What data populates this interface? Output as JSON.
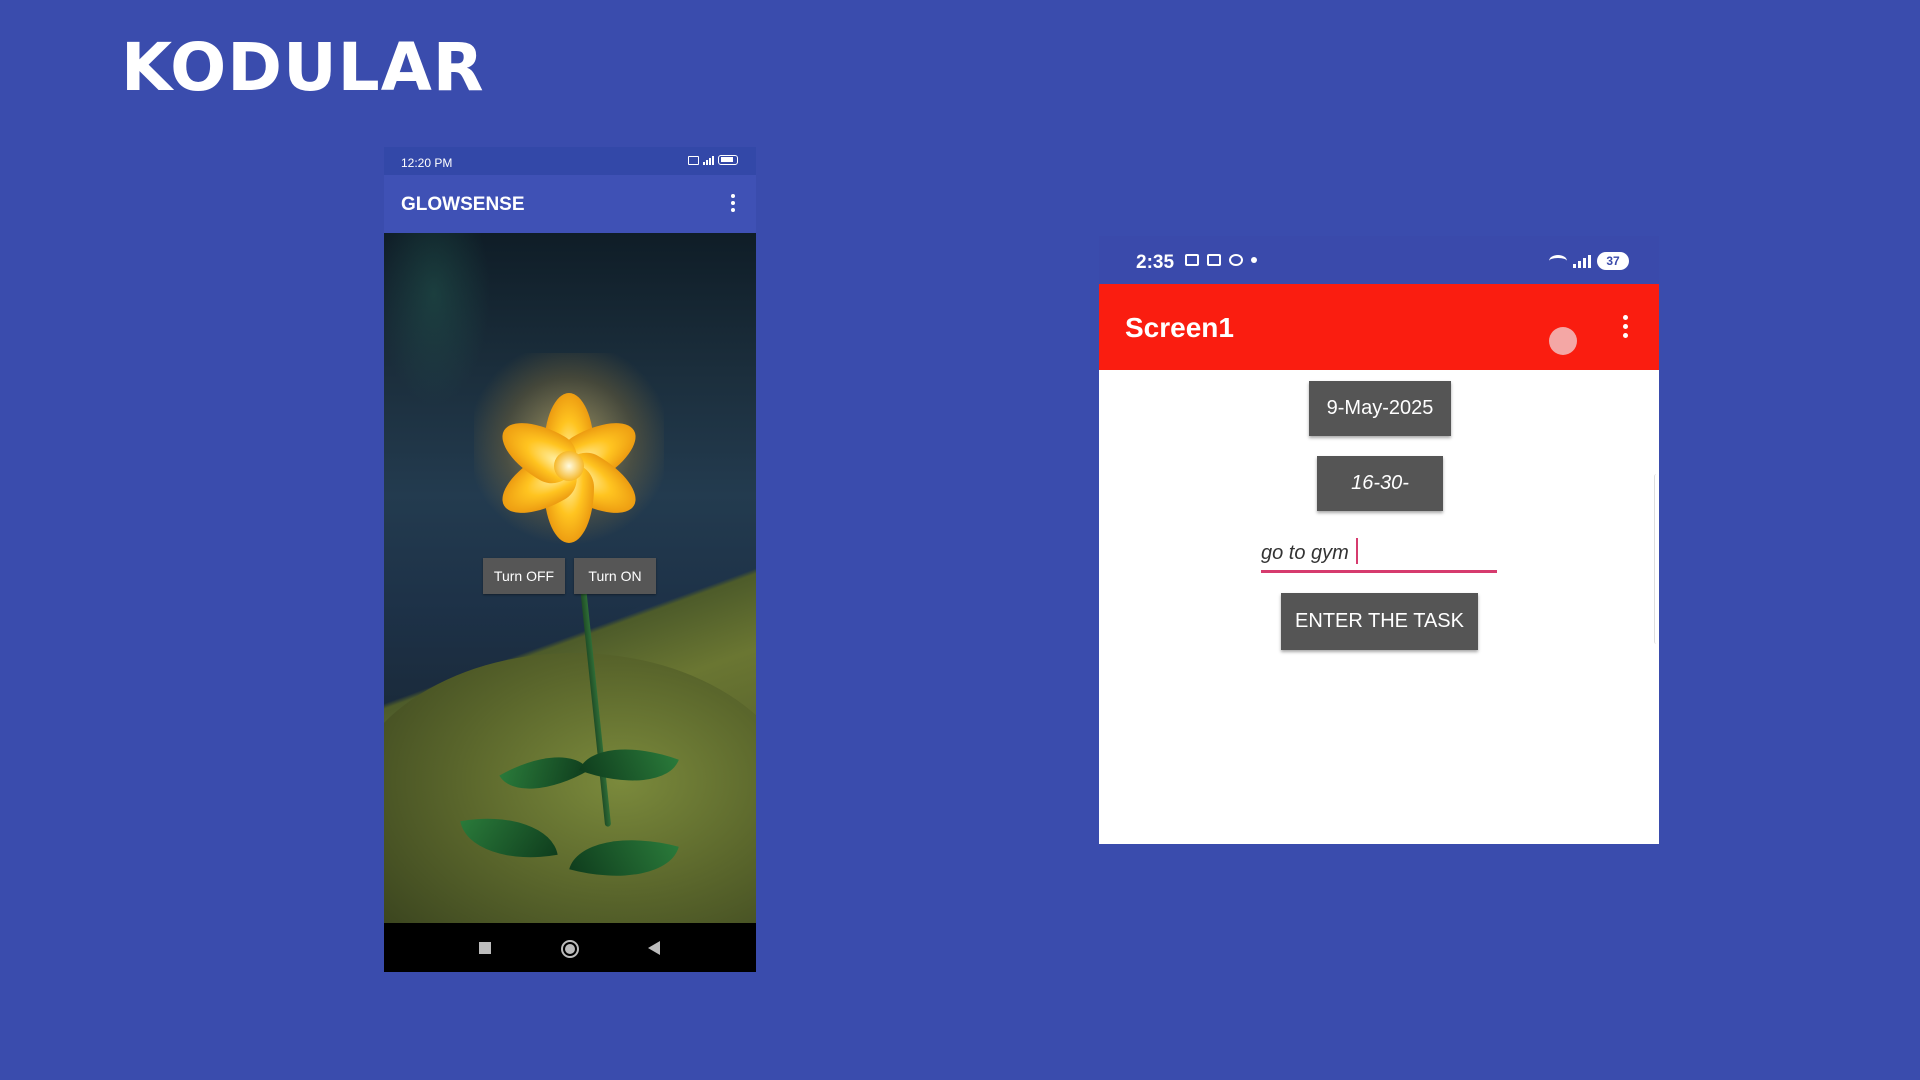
{
  "slide": {
    "title": "KODULAR"
  },
  "phone1": {
    "status_time": "12:20 PM",
    "app_title": "GLOWSENSE",
    "buttons": {
      "turn_off": "Turn OFF",
      "turn_on": "Turn ON"
    }
  },
  "phone2": {
    "status_time": "2:35",
    "battery": "37",
    "app_title": "Screen1",
    "date_button": "9-May-2025",
    "time_button": "16-30-",
    "task_input_value": "go to gym",
    "enter_button": "ENTER THE TASK"
  },
  "colors": {
    "slide_background": "#3a4cad",
    "phone1_appbar": "#3f51b5",
    "phone2_appbar": "#fa1d10",
    "button_gray": "#555555",
    "input_underline": "#d63b6e"
  }
}
